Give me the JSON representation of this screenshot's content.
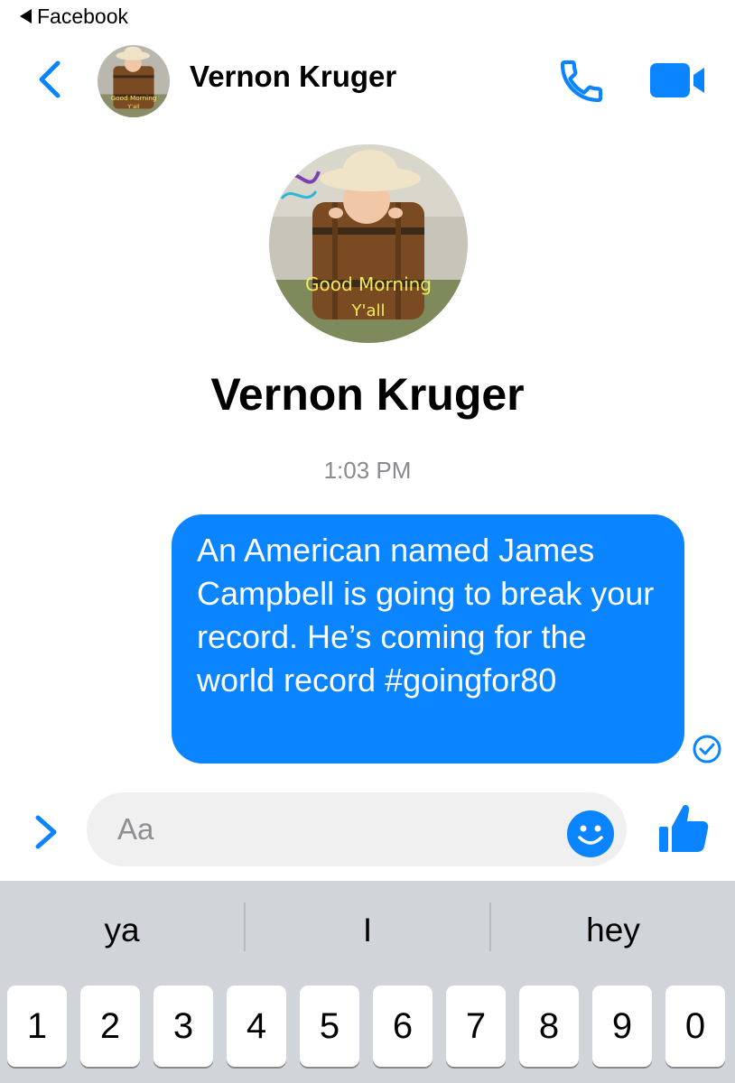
{
  "status_bar": {
    "back_app_label": "Facebook"
  },
  "header": {
    "contact_name": "Vernon Kruger"
  },
  "avatar": {
    "caption_line1": "Good Morning",
    "caption_line2": "Y'all"
  },
  "profile": {
    "name": "Vernon Kruger"
  },
  "conversation": {
    "timestamp": "1:03 PM",
    "messages": [
      {
        "sender": "me",
        "text": "An American named James Campbell is going to break your record. He’s coming for the world record #goingfor80",
        "status": "sent"
      }
    ]
  },
  "composer": {
    "placeholder": "Aa"
  },
  "keyboard": {
    "predictions": [
      "ya",
      "I",
      "hey"
    ],
    "number_row": [
      "1",
      "2",
      "3",
      "4",
      "5",
      "6",
      "7",
      "8",
      "9",
      "0"
    ]
  },
  "colors": {
    "accent": "#0a84ff",
    "bubble": "#0a84ff",
    "keyboard_bg": "#d1d4d9"
  },
  "icons": [
    "back-chevron",
    "phone",
    "video-camera",
    "chevron-right",
    "smiley",
    "thumbs-up",
    "check-circle"
  ]
}
